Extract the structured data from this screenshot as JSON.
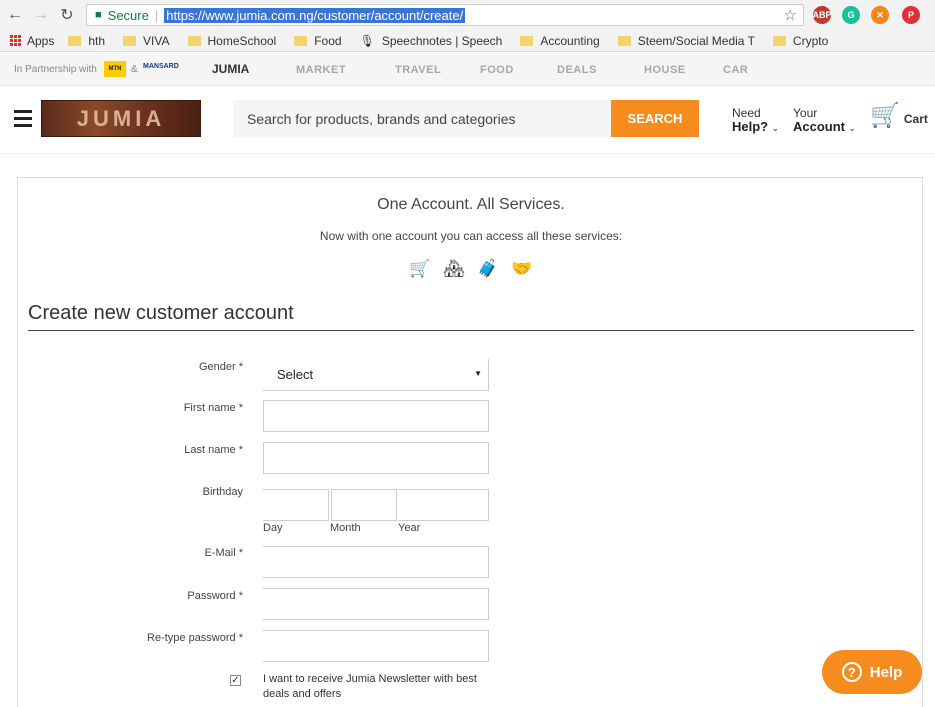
{
  "browser": {
    "secure_label": "Secure",
    "url": "https://www.jumia.com.ng/customer/account/create/",
    "back_icon": "←",
    "forward_icon": "→",
    "reload_icon": "↻",
    "star_icon": "☆"
  },
  "bookmarks": {
    "apps_label": "Apps",
    "items": [
      {
        "label": "hth"
      },
      {
        "label": "VIVA"
      },
      {
        "label": "HomeSchool"
      },
      {
        "label": "Food"
      },
      {
        "label": "Speechnotes | Speech"
      },
      {
        "label": "Accounting"
      },
      {
        "label": "Steem/Social Media T"
      },
      {
        "label": "Crypto"
      }
    ]
  },
  "partner": {
    "label": "In Partnership with",
    "amp": "&",
    "mtn": "MTN",
    "mansard": "MANSARD",
    "jumia": "JUMIA",
    "services": [
      "MARKET",
      "TRAVEL",
      "FOOD",
      "DEALS",
      "HOUSE",
      "CAR"
    ]
  },
  "header": {
    "logo_text": "JUMIA",
    "search_placeholder": "Search for products, brands and categories",
    "search_button": "SEARCH",
    "need_help_top": "Need",
    "need_help_bottom": "Help?",
    "account_top": "Your",
    "account_bottom": "Account",
    "cart_label": "Cart"
  },
  "main": {
    "title": "One Account. All Services.",
    "subtitle": "Now with one account you can access all these services:",
    "heading": "Create new customer account"
  },
  "form": {
    "gender_label": "Gender *",
    "gender_value": "Select",
    "first_name_label": "First name *",
    "last_name_label": "Last name *",
    "birthday_label": "Birthday",
    "day_label": "Day",
    "month_label": "Month",
    "year_label": "Year",
    "email_label": "E-Mail *",
    "password_label": "Password *",
    "retype_label": "Re-type password *",
    "newsletter_text": "I want to receive Jumia Newsletter with best deals and offers",
    "newsletter_checked": true
  },
  "help_button": "Help",
  "colors": {
    "accent": "#f68b1e",
    "secure": "#0b8043"
  }
}
